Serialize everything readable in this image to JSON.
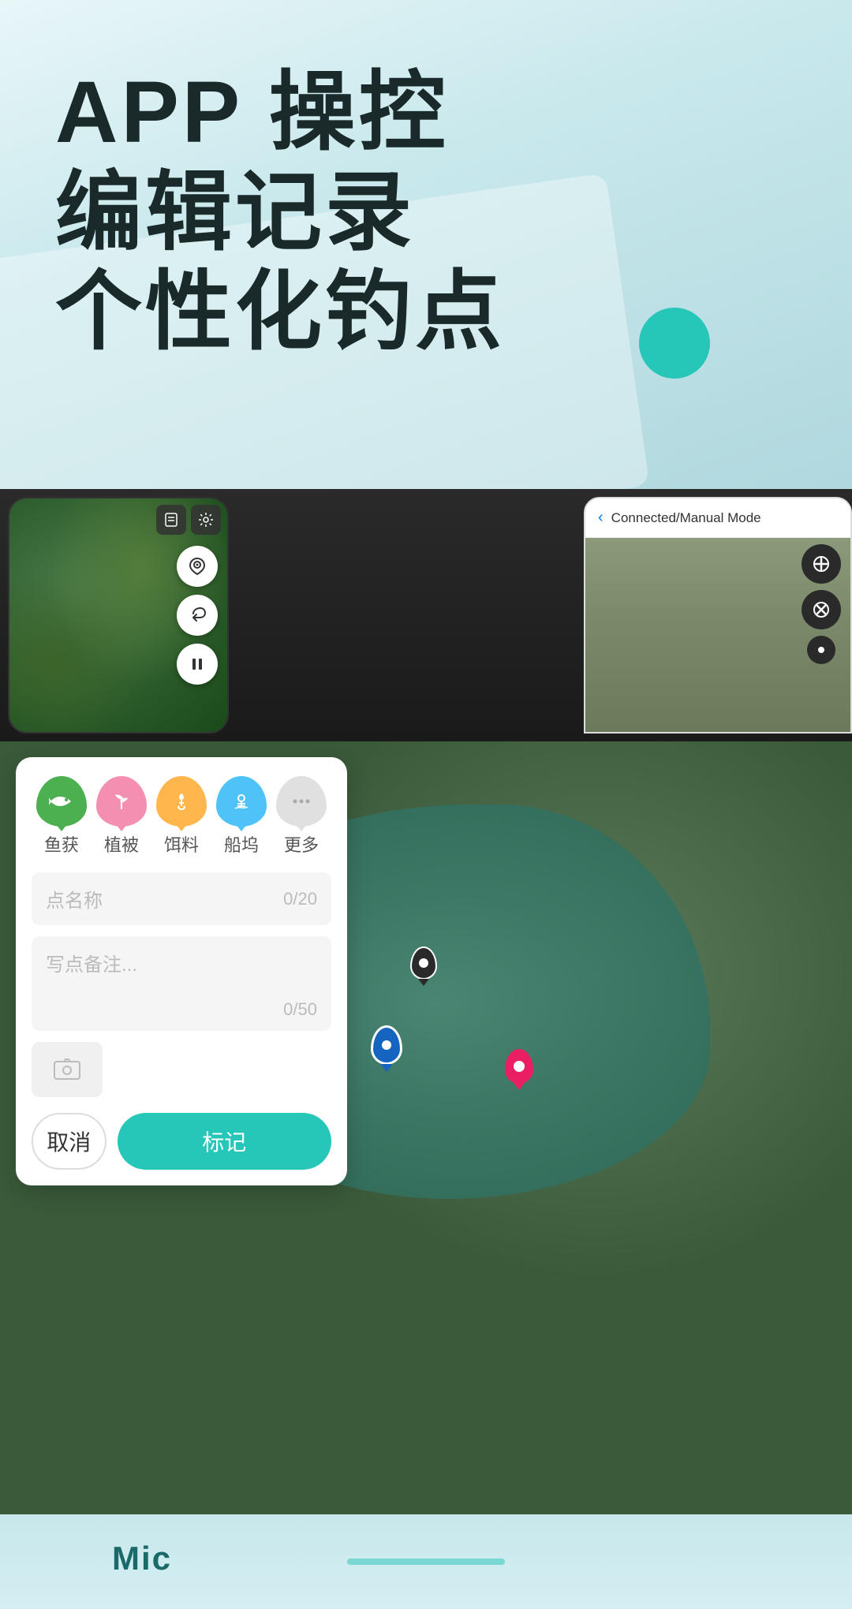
{
  "hero": {
    "line1": "APP 操控",
    "line2": "编辑记录",
    "line3": "个性化钓点"
  },
  "screenshots": {
    "right_header_title": "Connected/Manual Mode",
    "back_label": "‹"
  },
  "form": {
    "icons": [
      {
        "label": "鱼获",
        "color": "ic-green",
        "symbol": "🐟"
      },
      {
        "label": "植被",
        "color": "ic-pink",
        "symbol": "🌿"
      },
      {
        "label": "饵料",
        "color": "ic-orange",
        "symbol": "🪝"
      },
      {
        "label": "船坞",
        "color": "ic-blue",
        "symbol": "⚓"
      },
      {
        "label": "更多",
        "color": "ic-gray",
        "symbol": "···"
      }
    ],
    "name_placeholder": "点名称",
    "name_count": "0/20",
    "note_placeholder": "写点备注...",
    "note_count": "0/50",
    "cancel_label": "取消",
    "confirm_label": "标记"
  },
  "footer": {
    "mic_label": "Mic"
  }
}
